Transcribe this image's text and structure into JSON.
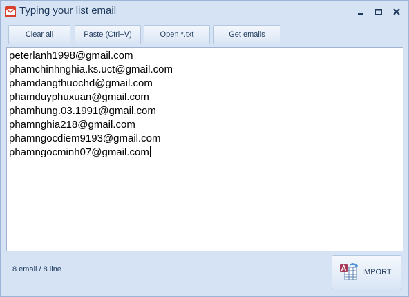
{
  "window": {
    "title": "Typing your list email",
    "icons": {
      "app": "mail-icon",
      "minimize": "minimize-icon",
      "restore": "restore-icon",
      "close": "close-icon"
    }
  },
  "toolbar": {
    "clear_label": "Clear all",
    "paste_label": "Paste (Ctrl+V)",
    "open_label": "Open *.txt",
    "get_emails_label": "Get emails"
  },
  "editor": {
    "lines": [
      "peterlanh1998@gmail.com",
      "phamchinhnghia.ks.uct@gmail.com",
      "phamdangthuochd@gmail.com",
      "phamduyphuxuan@gmail.com",
      "phamhung.03.1991@gmail.com",
      "phamnghia218@gmail.com",
      "phamngocdiem9193@gmail.com",
      "phamngocminh07@gmail.com"
    ]
  },
  "status": {
    "text": "8 email / 8 line"
  },
  "import": {
    "label": "IMPORT",
    "icon": "import-icon"
  },
  "colors": {
    "frame": "#d6e3f4",
    "border": "#9db4d6",
    "text": "#1e395b",
    "app_icon": "#d9412e"
  }
}
